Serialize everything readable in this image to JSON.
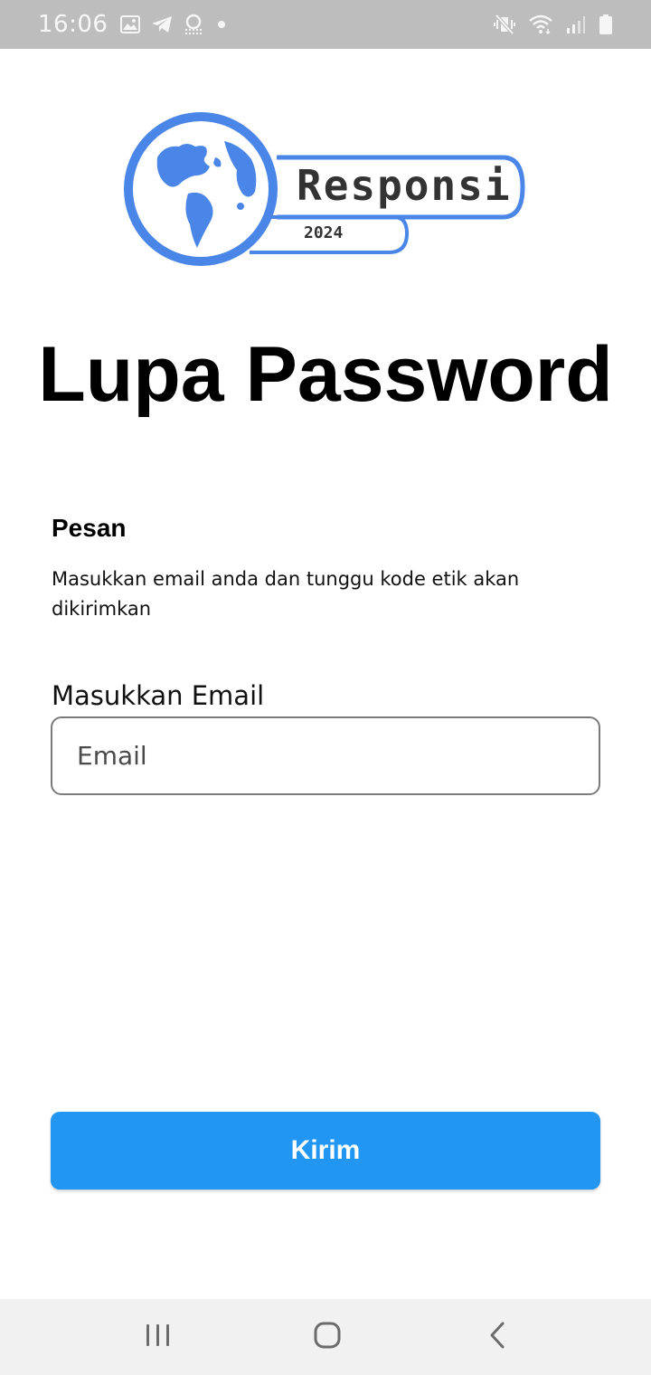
{
  "status_bar": {
    "time": "16:06",
    "left_icons": [
      "image-icon",
      "telegram-icon",
      "account-notification-icon",
      "dot-icon"
    ],
    "right_icons": [
      "mute-vibrate-icon",
      "wifi-icon",
      "signal-icon",
      "battery-icon"
    ]
  },
  "logo": {
    "name": "Responsi",
    "year": "2024",
    "accent_color": "#4a86e8"
  },
  "page": {
    "title": "Lupa Password"
  },
  "notice": {
    "title": "Pesan",
    "message": "Masukkan email anda dan tunggu kode etik akan dikirimkan"
  },
  "email_field": {
    "label": "Masukkan Email",
    "placeholder": "Email",
    "value": ""
  },
  "submit": {
    "label": "Kirim",
    "color": "#2196f3"
  },
  "nav_bar": {
    "buttons": [
      "recents-icon",
      "home-icon",
      "back-icon"
    ]
  }
}
